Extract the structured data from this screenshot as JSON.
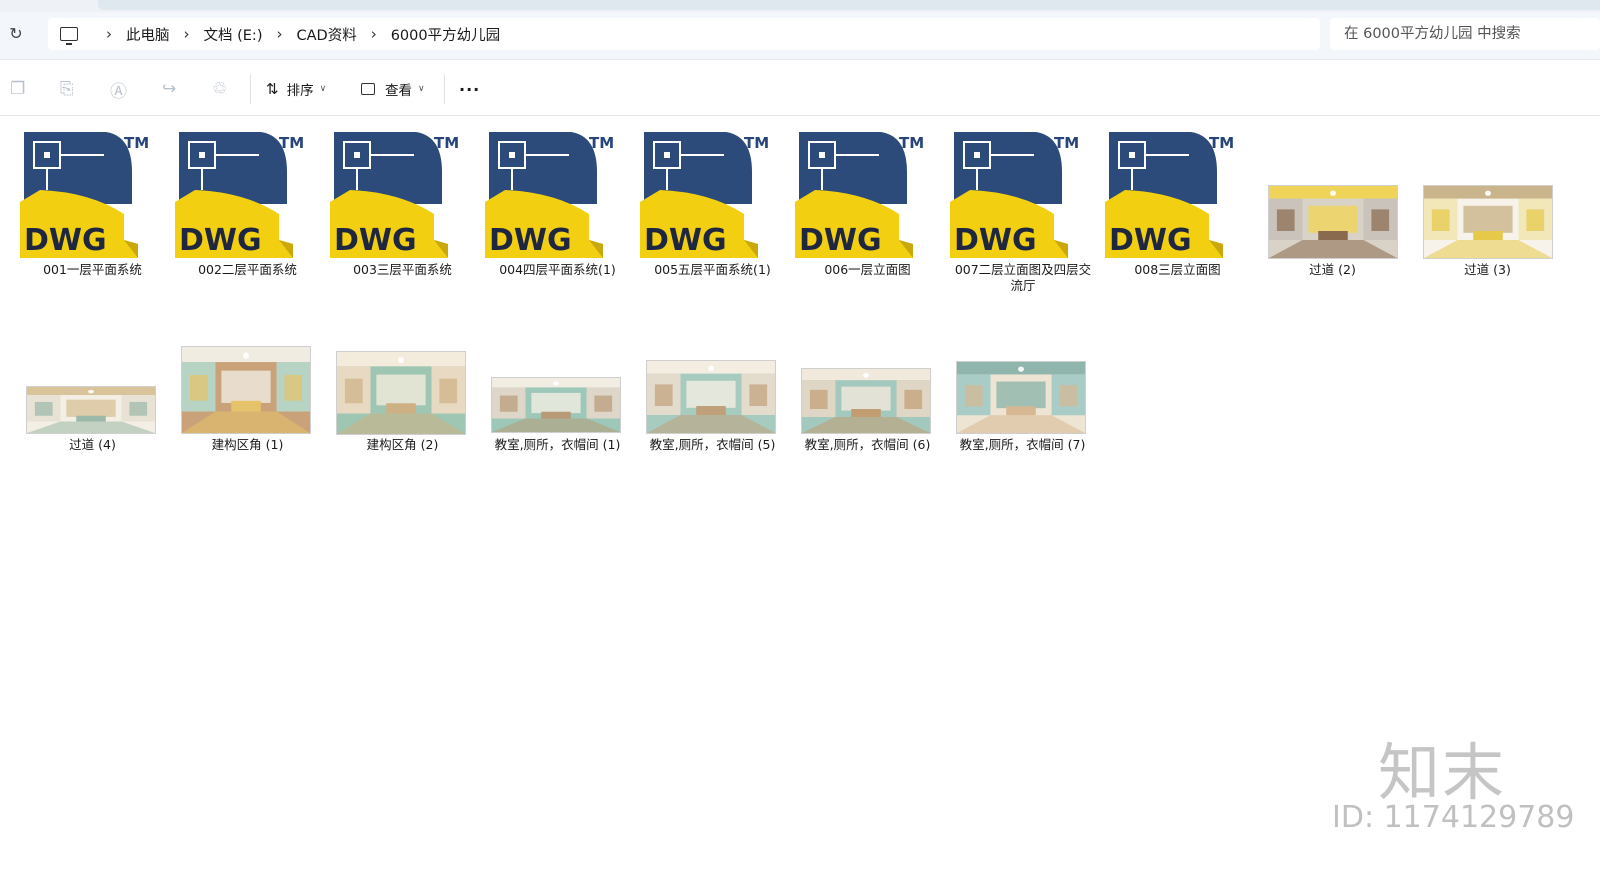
{
  "address": {
    "crumbs": [
      "此电脑",
      "文档 (E:)",
      "CAD资料",
      "6000平方幼儿园"
    ],
    "search_placeholder": "在 6000平方幼儿园 中搜索"
  },
  "toolbar": {
    "sort_label": "排序",
    "view_label": "查看",
    "more_label": "···"
  },
  "dwg_icon": {
    "text": "DWG",
    "tm": "TM",
    "yellow": "#f2cf10",
    "blue": "#2c4a7a"
  },
  "files": [
    {
      "name": "001一层平面系统",
      "kind": "dwg"
    },
    {
      "name": "002二层平面系统",
      "kind": "dwg"
    },
    {
      "name": "003三层平面系统",
      "kind": "dwg"
    },
    {
      "name": "004四层平面系统(1)",
      "kind": "dwg"
    },
    {
      "name": "005五层平面系统(1)",
      "kind": "dwg"
    },
    {
      "name": "006一层立面图",
      "kind": "dwg"
    },
    {
      "name": "007二层立面图及四层交流厅",
      "kind": "dwg"
    },
    {
      "name": "008三层立面图",
      "kind": "dwg"
    },
    {
      "name": "过道 (2)",
      "kind": "image",
      "palette": [
        "#c9c3bb",
        "#8a6a4e",
        "#d9d2c6",
        "#f0d45a"
      ]
    },
    {
      "name": "过道 (3)",
      "kind": "image",
      "palette": [
        "#f1e7b8",
        "#e7c94a",
        "#f7f3ea",
        "#c9b48b"
      ]
    },
    {
      "name": "过道 (4)",
      "kind": "image",
      "palette": [
        "#e8e2d4",
        "#9bb8a8",
        "#f4efe5",
        "#d8c39b"
      ]
    },
    {
      "name": "建构区角 (1)",
      "kind": "image",
      "palette": [
        "#b7d3c4",
        "#e6c36a",
        "#c9a27a",
        "#f0ece2"
      ]
    },
    {
      "name": "建构区角 (2)",
      "kind": "image",
      "palette": [
        "#e8d9c2",
        "#cdb084",
        "#9fc6b2",
        "#f3ebdb"
      ]
    },
    {
      "name": "教室,厕所，衣帽间 (1)",
      "kind": "image",
      "palette": [
        "#ded6c8",
        "#b89a76",
        "#9cc7b9",
        "#f2ede3"
      ]
    },
    {
      "name": "教室,厕所，衣帽间 (5)",
      "kind": "image",
      "palette": [
        "#e3dccd",
        "#bfa07a",
        "#a8cbbf",
        "#f3ede2"
      ]
    },
    {
      "name": "教室,厕所，衣帽间 (6)",
      "kind": "image",
      "palette": [
        "#e0d6c6",
        "#c29d72",
        "#a3c8bd",
        "#f1e9dc"
      ]
    },
    {
      "name": "教室,厕所，衣帽间 (7)",
      "kind": "image",
      "palette": [
        "#a9cdc6",
        "#d7b893",
        "#eee4d3",
        "#8fb5ad"
      ]
    }
  ],
  "brand": {
    "logo": "知末",
    "id_text": "ID: 1174129789"
  }
}
